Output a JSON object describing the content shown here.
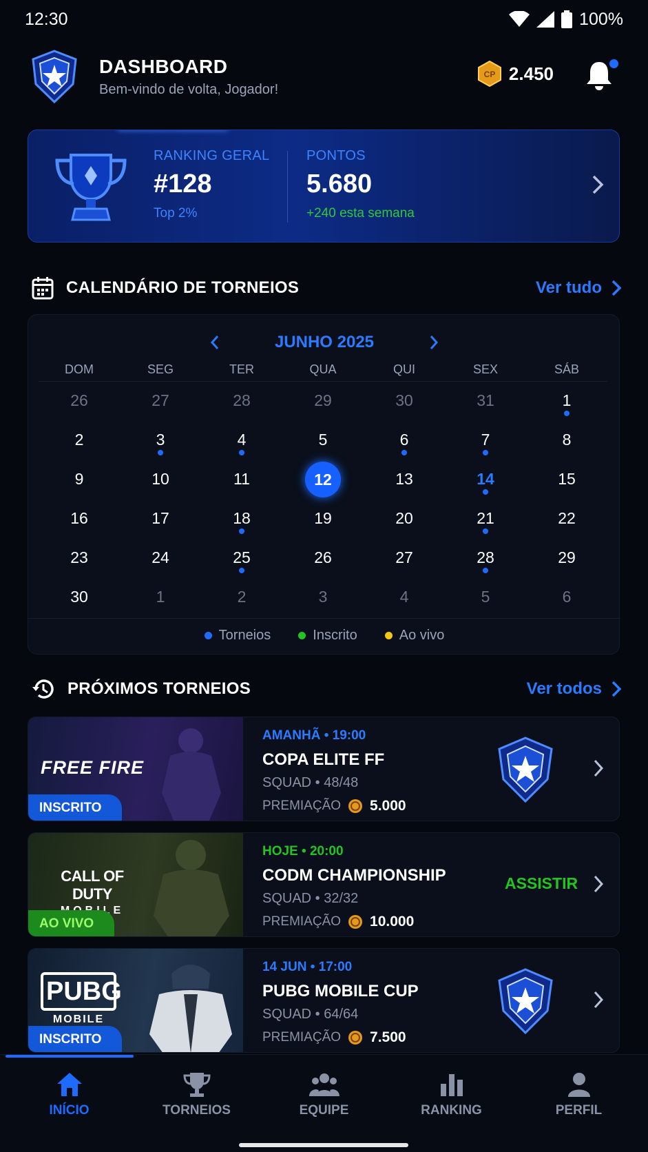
{
  "status": {
    "time": "12:30",
    "battery": "100%"
  },
  "header": {
    "title": "DASHBOARD",
    "subtitle": "Bem-vindo de volta, Jogador!",
    "coin_symbol": "CP",
    "coins": "2.450"
  },
  "ranking": {
    "rank_label": "RANKING GERAL",
    "rank_value": "#128",
    "rank_sub": "Top 2%",
    "points_label": "PONTOS",
    "points_value": "5.680",
    "points_sub": "+240 esta semana"
  },
  "calendar_section": {
    "title": "CALENDÁRIO DE TORNEIOS",
    "link": "Ver tudo"
  },
  "calendar": {
    "month": "JUNHO 2025",
    "weekdays": [
      "DOM",
      "SEG",
      "TER",
      "QUA",
      "QUI",
      "SEX",
      "SÁB"
    ],
    "weeks": [
      [
        "26",
        "27",
        "28",
        "29",
        "30",
        "31",
        "1"
      ],
      [
        "2",
        "3",
        "4",
        "5",
        "6",
        "7",
        "8"
      ],
      [
        "9",
        "10",
        "11",
        "12",
        "13",
        "14",
        "15"
      ],
      [
        "16",
        "17",
        "18",
        "19",
        "20",
        "21",
        "22"
      ],
      [
        "23",
        "24",
        "25",
        "26",
        "27",
        "28",
        "29"
      ],
      [
        "30",
        "1",
        "2",
        "3",
        "4",
        "5",
        "6"
      ]
    ],
    "legend": [
      {
        "label": "Torneios",
        "color": "#1e6bff"
      },
      {
        "label": "Inscrito",
        "color": "#22c422"
      },
      {
        "label": "Ao vivo",
        "color": "#f5c518"
      }
    ]
  },
  "upcoming_section": {
    "title": "PRÓXIMOS TORNEIOS",
    "link": "Ver todos"
  },
  "tournaments": [
    {
      "game_logo": "FREE FIRE",
      "badge": "INSCRITO",
      "when": "AMANHÃ • 19:00",
      "name": "COPA ELITE FF",
      "meta": "SQUAD • 48/48",
      "prize_label": "PREMIAÇÃO",
      "prize": "5.000"
    },
    {
      "game_logo_top": "CALL OF DUTY",
      "game_logo_bottom": "MOBILE",
      "badge": "AO VIVO",
      "when": "HOJE • 20:00",
      "name": "CODM CHAMPIONSHIP",
      "meta": "SQUAD • 32/32",
      "prize_label": "PREMIAÇÃO",
      "prize": "10.000",
      "action": "ASSISTIR"
    },
    {
      "game_logo_top": "PUBG",
      "game_logo_bottom": "MOBILE",
      "badge": "INSCRITO",
      "when": "14 JUN • 17:00",
      "name": "PUBG MOBILE CUP",
      "meta": "SQUAD • 64/64",
      "prize_label": "PREMIAÇÃO",
      "prize": "7.500"
    }
  ],
  "nav": [
    {
      "label": "INÍCIO",
      "icon": "home-icon"
    },
    {
      "label": "TORNEIOS",
      "icon": "trophy-icon"
    },
    {
      "label": "EQUIPE",
      "icon": "team-icon"
    },
    {
      "label": "RANKING",
      "icon": "ranking-icon"
    },
    {
      "label": "PERFIL",
      "icon": "profile-icon"
    }
  ],
  "colors": {
    "accent": "#1e6bff",
    "live": "#22c422",
    "warn": "#f5c518"
  }
}
